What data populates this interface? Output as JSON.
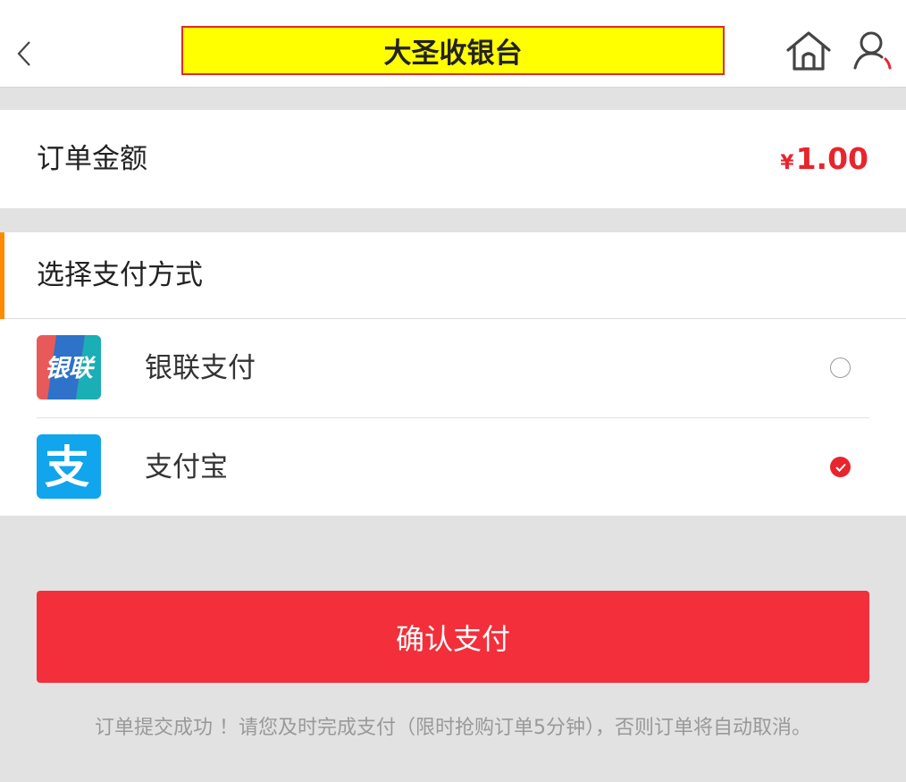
{
  "header": {
    "title": "大圣收银台",
    "back_icon": "chevron-left-icon",
    "home_icon": "home-icon",
    "user_icon": "user-icon",
    "title_bg_color": "#ffff00",
    "title_border_color": "#e02a2a"
  },
  "order": {
    "label": "订单金额",
    "currency_symbol": "¥",
    "amount": "1.00",
    "amount_color": "#e8252c"
  },
  "payment": {
    "section_title": "选择支付方式",
    "accent_color": "#ff8a00",
    "options": [
      {
        "label": "银联支付",
        "icon": "unionpay-icon",
        "icon_text": "银联",
        "selected": false
      },
      {
        "label": "支付宝",
        "icon": "alipay-icon",
        "icon_text": "支",
        "selected": true
      }
    ]
  },
  "actions": {
    "confirm_label": "确认支付",
    "confirm_color": "#f22f3a"
  },
  "notice": "订单提交成功 ！请您及时完成支付（限时抢购订单5分钟），否则订单将自动取消。"
}
